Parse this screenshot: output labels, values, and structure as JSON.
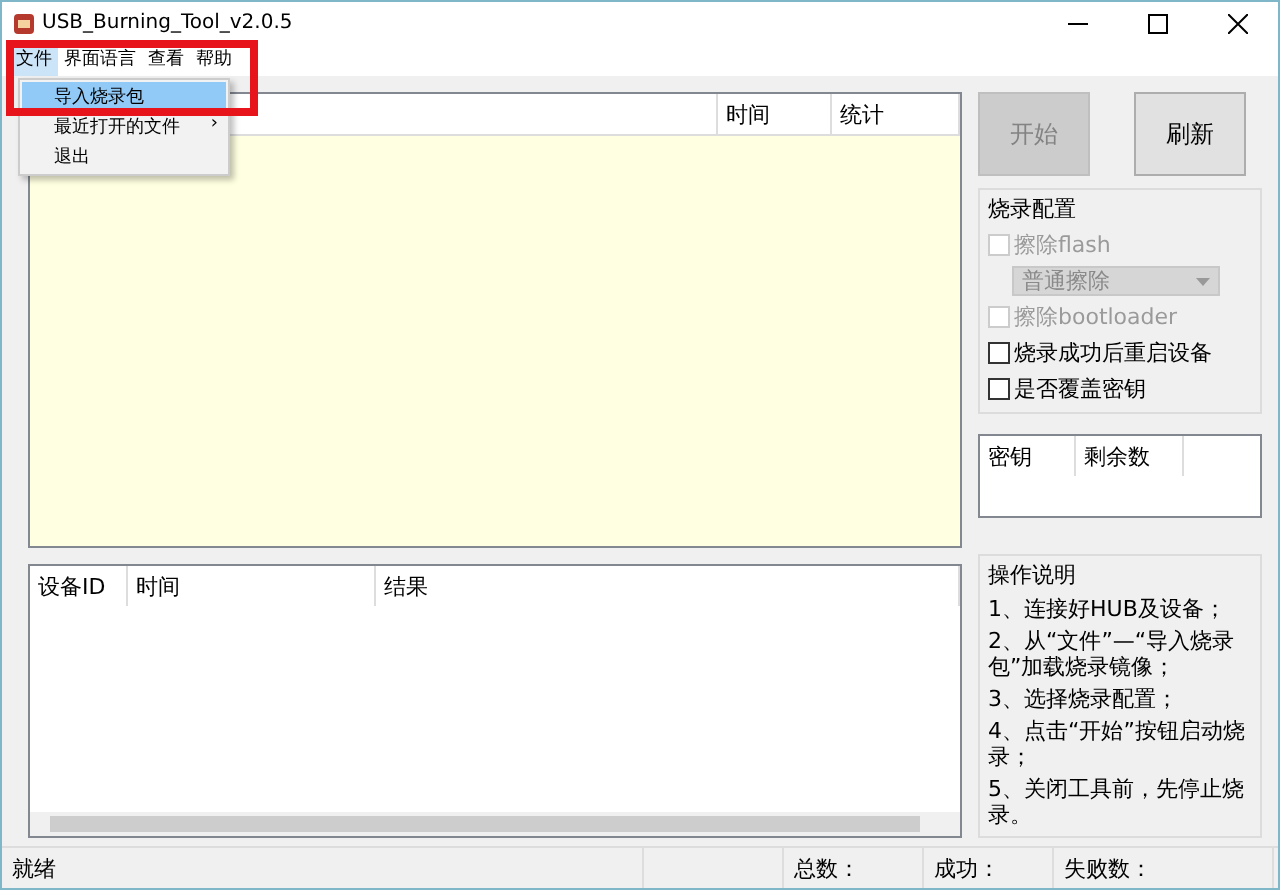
{
  "window": {
    "title": "USB_Burning_Tool_v2.0.5"
  },
  "menu_bar": [
    {
      "label": "文件",
      "selected": true
    },
    {
      "label": "界面语言",
      "selected": false
    },
    {
      "label": "查看",
      "selected": false
    },
    {
      "label": "帮助",
      "selected": false
    }
  ],
  "file_menu": [
    {
      "label": "导入烧录包",
      "selected": true
    },
    {
      "label": "最近打开的文件",
      "selected": false,
      "submenu": "›"
    },
    {
      "label": "退出",
      "selected": false
    }
  ],
  "device_table": {
    "columns": [
      "",
      "时间",
      "统计"
    ]
  },
  "buttons": [
    {
      "label": "开始",
      "disabled": true
    },
    {
      "label": "刷新",
      "disabled": false
    }
  ],
  "burn_config": {
    "title": "烧录配置",
    "options": [
      {
        "kind": "checkbox",
        "label": "擦除flash",
        "checked": false,
        "disabled": true
      },
      {
        "kind": "select",
        "value": "普通擦除",
        "disabled": true
      },
      {
        "kind": "checkbox",
        "label": "擦除bootloader",
        "checked": false,
        "disabled": true
      },
      {
        "kind": "checkbox",
        "label": "烧录成功后重启设备",
        "checked": false,
        "disabled": false
      },
      {
        "kind": "checkbox",
        "label": "是否覆盖密钥",
        "checked": false,
        "disabled": false
      }
    ]
  },
  "key_table": {
    "columns": [
      "密钥",
      "剩余数"
    ]
  },
  "result_table": {
    "columns": [
      "设备ID",
      "时间",
      "结果"
    ]
  },
  "instructions": {
    "title": "操作说明",
    "lines": [
      "1、连接好HUB及设备；",
      "2、从“文件”—“导入烧录包”加载烧录镜像；",
      "3、选择烧录配置；",
      "4、点击“开始”按钮启动烧录；",
      "5、关闭工具前，先停止烧录。"
    ]
  },
  "status_bar": {
    "status": "就绪",
    "total": "总数：",
    "success": "成功：",
    "failed": "失败数："
  }
}
